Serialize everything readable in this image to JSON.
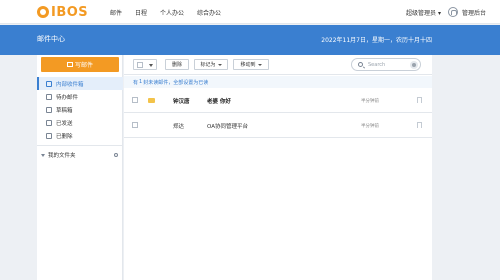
{
  "brand": {
    "logo_text": "IBOS",
    "accent": "#f39a23",
    "primary": "#3a7fd0"
  },
  "nav": {
    "items": [
      "邮件",
      "日程",
      "个人办公",
      "综合办公"
    ]
  },
  "user": {
    "name": "超级管理员",
    "admin_link": "管理后台"
  },
  "banner": {
    "title": "邮件中心",
    "date": "2022年11月7日，星期一，农历十月十四"
  },
  "sidebar": {
    "compose_label": "写邮件",
    "items": [
      {
        "label": "内部收件箱",
        "icon": "inbox-icon",
        "active": true
      },
      {
        "label": "待办邮件",
        "icon": "bookmark-icon",
        "active": false
      },
      {
        "label": "草稿箱",
        "icon": "draft-icon",
        "active": false
      },
      {
        "label": "已发送",
        "icon": "send-icon",
        "active": false
      },
      {
        "label": "已删除",
        "icon": "trash-icon",
        "active": false
      }
    ],
    "folder_label": "我的文件夹"
  },
  "toolbar": {
    "delete_label": "删除",
    "mark_label": "标记为",
    "move_label": "移动到"
  },
  "search": {
    "placeholder": "Search"
  },
  "notice": {
    "prefix": "有",
    "count": "1",
    "middle": "封未读邮件，",
    "link": "全部设置为已读"
  },
  "mails": [
    {
      "sender": "钟汉唐",
      "subject": "老婆 你好",
      "time": "半分钟前",
      "unread": true
    },
    {
      "sender": "郑达",
      "subject": "OA协同管理平台",
      "time": "半分钟前",
      "unread": false
    }
  ]
}
